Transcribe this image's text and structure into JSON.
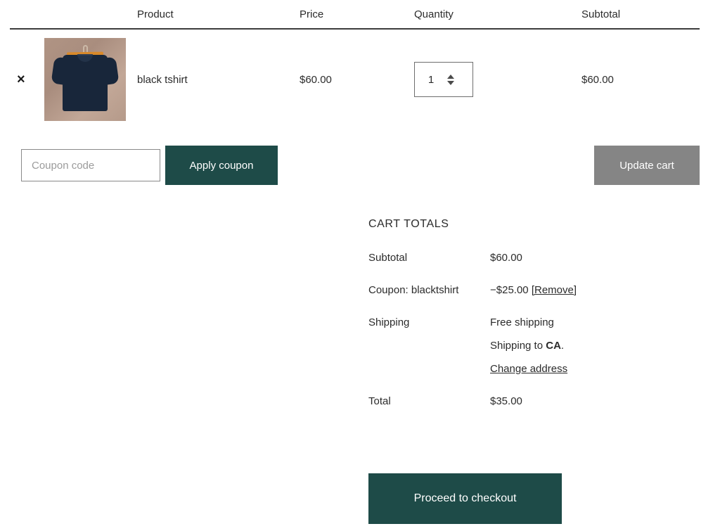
{
  "table": {
    "headers": {
      "remove": "",
      "product": "Product",
      "price": "Price",
      "quantity": "Quantity",
      "subtotal": "Subtotal"
    },
    "rows": [
      {
        "remove_icon": "×",
        "thumbnail_alt": "black tshirt product image",
        "name": "black tshirt",
        "price": "$60.00",
        "quantity": "1",
        "subtotal": "$60.00"
      }
    ]
  },
  "coupon": {
    "placeholder": "Coupon code",
    "value": "",
    "apply_label": "Apply coupon"
  },
  "update_cart": {
    "label": "Update cart",
    "disabled": true
  },
  "totals": {
    "title": "CART TOTALS",
    "subtotal_label": "Subtotal",
    "subtotal_value": "$60.00",
    "coupon_label": "Coupon: blacktshirt",
    "coupon_value": "−$25.00",
    "coupon_remove": "[Remove]",
    "shipping_label": "Shipping",
    "shipping_method": "Free shipping",
    "shipping_to_prefix": "Shipping to ",
    "shipping_to_state": "CA",
    "shipping_to_suffix": ".",
    "change_address": "Change address",
    "total_label": "Total",
    "total_value": "$35.00"
  },
  "checkout": {
    "label": "Proceed to checkout"
  },
  "colors": {
    "accent_teal": "#1e4b48",
    "disabled_grey": "#858585",
    "text": "#2b2b2b",
    "placeholder": "#9b9b9b",
    "border": "#8a8a8a",
    "header_rule": "#3c3c3c"
  }
}
